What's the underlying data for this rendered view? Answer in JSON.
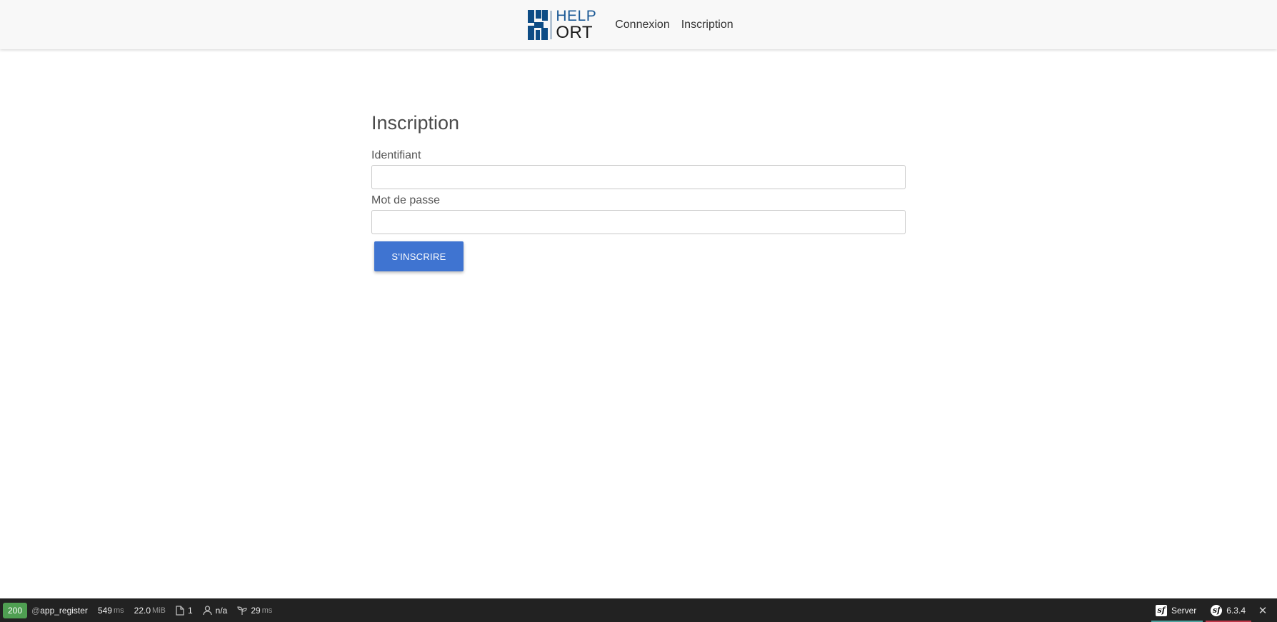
{
  "nav": {
    "logo": {
      "line1": "HELP",
      "line2": "ORT"
    },
    "links": [
      {
        "label": "Connexion"
      },
      {
        "label": "Inscription"
      }
    ]
  },
  "form": {
    "title": "Inscription",
    "fields": [
      {
        "label": "Identifiant",
        "value": "",
        "placeholder": ""
      },
      {
        "label": "Mot de passe",
        "value": "",
        "placeholder": ""
      }
    ],
    "submit_label": "S'INSCRIRE"
  },
  "debug_toolbar": {
    "status_code": "200",
    "route_prefix": "@",
    "route": "app_register",
    "time_value": "549",
    "time_unit": "ms",
    "memory_value": "22.0",
    "memory_unit": "MiB",
    "requests_count": "1",
    "user": "n/a",
    "twig_value": "29",
    "twig_unit": "ms",
    "server_label": "Server",
    "version": "6.3.4",
    "colors": {
      "status_ok": "#4f9f52",
      "background": "#222222"
    }
  },
  "colors": {
    "primary_button": "#3f74d1",
    "logo_blue": "#1c5a96",
    "nav_background": "#f8f8f8"
  }
}
